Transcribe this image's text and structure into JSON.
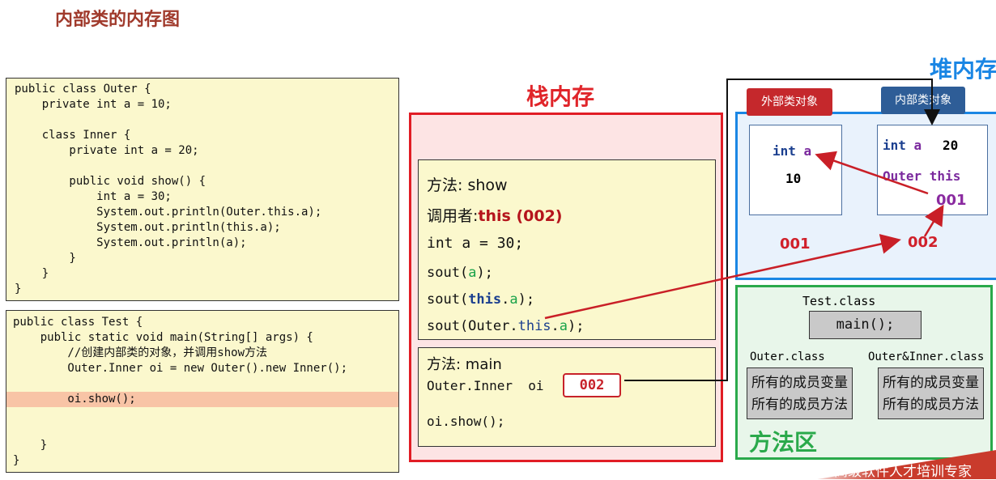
{
  "title": "内部类的内存图",
  "outer_code": [
    "public class Outer {",
    "    private int a = 10;",
    "",
    "    class Inner {",
    "        private int a = 20;",
    "",
    "        public void show() {",
    "            int a = 30;",
    "            System.out.println(Outer.this.a);",
    "            System.out.println(this.a);",
    "            System.out.println(a);",
    "        }",
    "    }",
    "}"
  ],
  "test_code": [
    "public class Test {",
    "    public static void main(String[] args) {",
    "        //创建内部类的对象，并调用show方法",
    "        Outer.Inner oi = new Outer().new Inner();",
    "",
    "        oi.show();",
    "",
    "",
    "    }",
    "}"
  ],
  "stack": {
    "title": "栈内存",
    "show_frame": {
      "method_label": "方法: show",
      "caller_label": "调用者:",
      "caller_value": "this (002)",
      "local_var": "int a = 30;",
      "sout1_prefix": "sout(",
      "sout1_arg": "a",
      "sout1_suffix": ");",
      "sout2_prefix": "sout(",
      "sout2_this": "this",
      "sout2_rest": ".",
      "sout2_a": "a",
      "sout2_suffix": ");",
      "sout3_prefix": "sout(Outer.",
      "sout3_this": "this",
      "sout3_dot": ".",
      "sout3_a": "a",
      "sout3_suffix": ");"
    },
    "main_frame": {
      "method_label": "方法: main",
      "var_decl": "Outer.Inner  oi",
      "ref_value": "002",
      "call": "oi.show();"
    }
  },
  "heap": {
    "title": "堆内存",
    "outer_object": {
      "tag": "外部类对象",
      "field": "int a",
      "value": "10",
      "address": "001"
    },
    "inner_object": {
      "tag": "内部类对象",
      "field": "int a",
      "value": "20",
      "outer_ref_label": "Outer this",
      "outer_ref_value": "001",
      "address": "002"
    }
  },
  "method_area": {
    "title": "方法区",
    "test_class": "Test.class",
    "test_method": "main();",
    "outer_class": "Outer.class",
    "inner_class": "Outer&Inner.class",
    "members_vars": "所有的成员变量",
    "members_methods": "所有的成员方法"
  },
  "watermark": "高级软件人才培训专家",
  "colors": {
    "stack_red": "#e11d25",
    "heap_blue": "#1a86e4",
    "method_green": "#2aa94b",
    "code_bg": "#fbf8cd",
    "highlight": "#f8c4a6",
    "outer_tag": "#c5282c",
    "inner_tag": "#2e5d97"
  }
}
